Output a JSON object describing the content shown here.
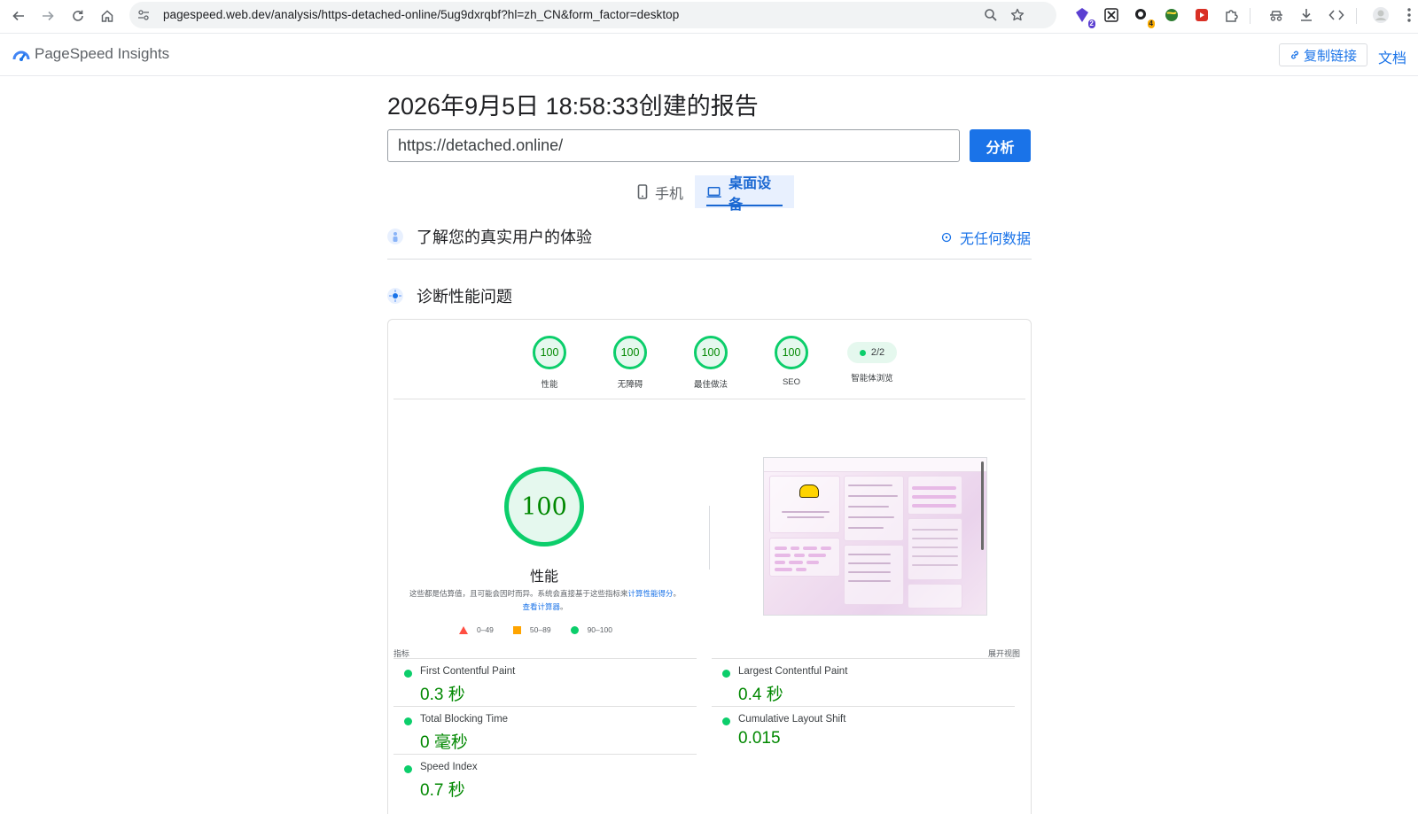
{
  "browser": {
    "url": "pagespeed.web.dev/analysis/https-detached-online/5ug9dxrqbf?hl=zh_CN&form_factor=desktop",
    "extension_badges": [
      "2",
      "4"
    ]
  },
  "header": {
    "brand": "PageSpeed Insights",
    "copy_link": "复制链接",
    "docs": "文档"
  },
  "report": {
    "title": "2026年9月5日 18:58:33创建的报告",
    "url_value": "https://detached.online/",
    "analyze": "分析"
  },
  "tabs": [
    {
      "label": "手机",
      "selected": false
    },
    {
      "label": "桌面设备",
      "selected": true
    }
  ],
  "crux": {
    "title": "了解您的真实用户的体验",
    "no_data": "无任何数据"
  },
  "diagnose": {
    "title": "诊断性能问题"
  },
  "categories": [
    {
      "score": "100",
      "label": "性能"
    },
    {
      "score": "100",
      "label": "无障碍"
    },
    {
      "score": "100",
      "label": "最佳做法"
    },
    {
      "score": "100",
      "label": "SEO"
    }
  ],
  "agentic": {
    "score": "2/2",
    "label": "智能体浏览"
  },
  "performance": {
    "score": "100",
    "title": "性能",
    "desc_prefix": "这些都是估算值，且可能会因时而异。系统会直接基于这些指标来",
    "desc_link1": "计算性能得分",
    "desc_sep": "。",
    "desc_link2": "查看计算器",
    "desc_suffix": "。"
  },
  "legend": [
    "0–49",
    "50–89",
    "90–100"
  ],
  "metrics_label": "指标",
  "expand_view": "展开视图",
  "metrics": [
    {
      "name": "First Contentful Paint",
      "value": "0.3 秒"
    },
    {
      "name": "Largest Contentful Paint",
      "value": "0.4 秒"
    },
    {
      "name": "Total Blocking Time",
      "value": "0 毫秒"
    },
    {
      "name": "Cumulative Layout Shift",
      "value": "0.015"
    },
    {
      "name": "Speed Index",
      "value": "0.7 秒"
    }
  ],
  "colors": {
    "accent": "#1a73e8",
    "pass": "#0cce6b",
    "pass_text": "#008800",
    "average": "#ffa400",
    "fail": "#ff4e42"
  }
}
